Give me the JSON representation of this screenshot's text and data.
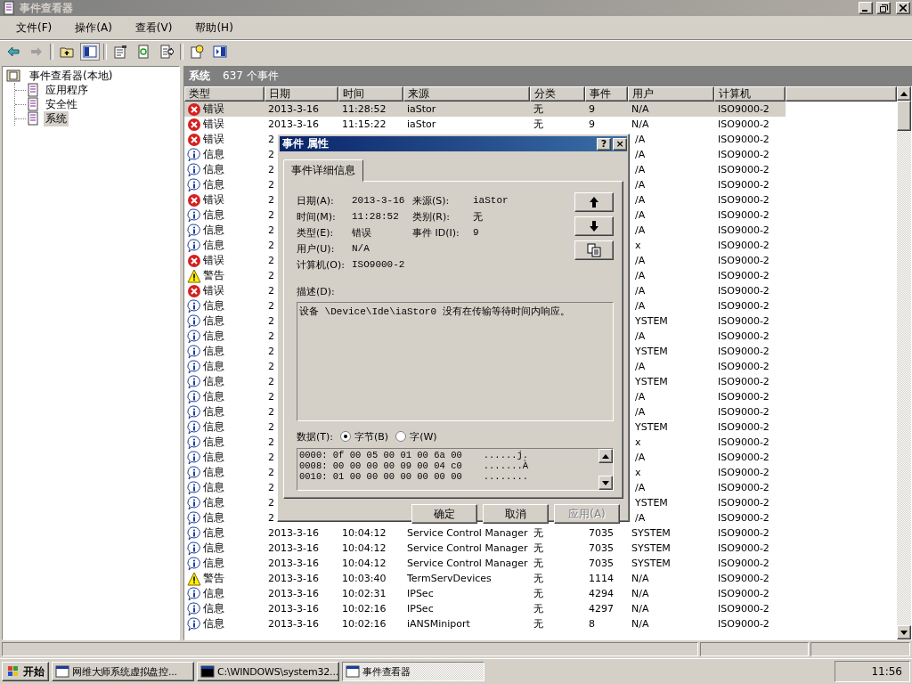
{
  "window": {
    "title": "事件查看器"
  },
  "menu": [
    {
      "label": "文件(F)"
    },
    {
      "label": "操作(A)"
    },
    {
      "label": "查看(V)"
    },
    {
      "label": "帮助(H)"
    }
  ],
  "tree": {
    "label": "事件查看器(本地)",
    "children": [
      {
        "label": "应用程序",
        "selected": false
      },
      {
        "label": "安全性",
        "selected": false
      },
      {
        "label": "系统",
        "selected": true
      }
    ]
  },
  "panel": {
    "title": "系统",
    "count": "637 个事件"
  },
  "table": {
    "columns": [
      "类型",
      "日期",
      "时间",
      "来源",
      "分类",
      "事件",
      "用户",
      "计算机"
    ],
    "rows": [
      {
        "kind": "error",
        "type": "错误",
        "selected": true,
        "date": "2013-3-16",
        "time": "11:28:52",
        "source": "iaStor",
        "category": "无",
        "event": "9",
        "user": "N/A",
        "computer": "ISO9000-2"
      },
      {
        "kind": "error",
        "type": "错误",
        "selected": false,
        "date": "2013-3-16",
        "time": "11:15:22",
        "source": "iaStor",
        "category": "无",
        "event": "9",
        "user": "N/A",
        "computer": "ISO9000-2"
      },
      {
        "kind": "error",
        "type": "错误",
        "selected": false,
        "date": "2",
        "user": "/A",
        "computer": "ISO9000-2"
      },
      {
        "kind": "info",
        "type": "信息",
        "selected": false,
        "date": "2",
        "user": "/A",
        "computer": "ISO9000-2"
      },
      {
        "kind": "info",
        "type": "信息",
        "selected": false,
        "date": "2",
        "user": "/A",
        "computer": "ISO9000-2"
      },
      {
        "kind": "info",
        "type": "信息",
        "selected": false,
        "date": "2",
        "user": "/A",
        "computer": "ISO9000-2"
      },
      {
        "kind": "error",
        "type": "错误",
        "selected": false,
        "date": "2",
        "user": "/A",
        "computer": "ISO9000-2"
      },
      {
        "kind": "info",
        "type": "信息",
        "selected": false,
        "date": "2",
        "user": "/A",
        "computer": "ISO9000-2"
      },
      {
        "kind": "info",
        "type": "信息",
        "selected": false,
        "date": "2",
        "user": "/A",
        "computer": "ISO9000-2"
      },
      {
        "kind": "info",
        "type": "信息",
        "selected": false,
        "date": "2",
        "user": "x",
        "computer": "ISO9000-2"
      },
      {
        "kind": "error",
        "type": "错误",
        "selected": false,
        "date": "2",
        "user": "/A",
        "computer": "ISO9000-2"
      },
      {
        "kind": "warning",
        "type": "警告",
        "selected": false,
        "date": "2",
        "user": "/A",
        "computer": "ISO9000-2"
      },
      {
        "kind": "error",
        "type": "错误",
        "selected": false,
        "date": "2",
        "user": "/A",
        "computer": "ISO9000-2"
      },
      {
        "kind": "info",
        "type": "信息",
        "selected": false,
        "date": "2",
        "user": "/A",
        "computer": "ISO9000-2"
      },
      {
        "kind": "info",
        "type": "信息",
        "selected": false,
        "date": "2",
        "user": "YSTEM",
        "computer": "ISO9000-2"
      },
      {
        "kind": "info",
        "type": "信息",
        "selected": false,
        "date": "2",
        "user": "/A",
        "computer": "ISO9000-2"
      },
      {
        "kind": "info",
        "type": "信息",
        "selected": false,
        "date": "2",
        "user": "YSTEM",
        "computer": "ISO9000-2"
      },
      {
        "kind": "info",
        "type": "信息",
        "selected": false,
        "date": "2",
        "user": "/A",
        "computer": "ISO9000-2"
      },
      {
        "kind": "info",
        "type": "信息",
        "selected": false,
        "date": "2",
        "user": "YSTEM",
        "computer": "ISO9000-2"
      },
      {
        "kind": "info",
        "type": "信息",
        "selected": false,
        "date": "2",
        "user": "/A",
        "computer": "ISO9000-2"
      },
      {
        "kind": "info",
        "type": "信息",
        "selected": false,
        "date": "2",
        "user": "/A",
        "computer": "ISO9000-2"
      },
      {
        "kind": "info",
        "type": "信息",
        "selected": false,
        "date": "2",
        "user": "YSTEM",
        "computer": "ISO9000-2"
      },
      {
        "kind": "info",
        "type": "信息",
        "selected": false,
        "date": "2",
        "user": "x",
        "computer": "ISO9000-2"
      },
      {
        "kind": "info",
        "type": "信息",
        "selected": false,
        "date": "2",
        "user": "/A",
        "computer": "ISO9000-2"
      },
      {
        "kind": "info",
        "type": "信息",
        "selected": false,
        "date": "2",
        "user": "x",
        "computer": "ISO9000-2"
      },
      {
        "kind": "info",
        "type": "信息",
        "selected": false,
        "date": "2",
        "user": "/A",
        "computer": "ISO9000-2"
      },
      {
        "kind": "info",
        "type": "信息",
        "selected": false,
        "date": "2",
        "user": "YSTEM",
        "computer": "ISO9000-2"
      },
      {
        "kind": "info",
        "type": "信息",
        "selected": false,
        "date": "2",
        "user": "/A",
        "computer": "ISO9000-2"
      },
      {
        "kind": "info",
        "type": "信息",
        "selected": false,
        "date": "2013-3-16",
        "time": "10:04:12",
        "source": "Service Control Manager",
        "category": "无",
        "event": "7035",
        "user": "SYSTEM",
        "computer": "ISO9000-2"
      },
      {
        "kind": "info",
        "type": "信息",
        "selected": false,
        "date": "2013-3-16",
        "time": "10:04:12",
        "source": "Service Control Manager",
        "category": "无",
        "event": "7035",
        "user": "SYSTEM",
        "computer": "ISO9000-2"
      },
      {
        "kind": "info",
        "type": "信息",
        "selected": false,
        "date": "2013-3-16",
        "time": "10:04:12",
        "source": "Service Control Manager",
        "category": "无",
        "event": "7035",
        "user": "SYSTEM",
        "computer": "ISO9000-2"
      },
      {
        "kind": "warning",
        "type": "警告",
        "selected": false,
        "date": "2013-3-16",
        "time": "10:03:40",
        "source": "TermServDevices",
        "category": "无",
        "event": "1114",
        "user": "N/A",
        "computer": "ISO9000-2"
      },
      {
        "kind": "info",
        "type": "信息",
        "selected": false,
        "date": "2013-3-16",
        "time": "10:02:31",
        "source": "IPSec",
        "category": "无",
        "event": "4294",
        "user": "N/A",
        "computer": "ISO9000-2"
      },
      {
        "kind": "info",
        "type": "信息",
        "selected": false,
        "date": "2013-3-16",
        "time": "10:02:16",
        "source": "IPSec",
        "category": "无",
        "event": "4297",
        "user": "N/A",
        "computer": "ISO9000-2"
      },
      {
        "kind": "info",
        "type": "信息",
        "selected": false,
        "date": "2013-3-16",
        "time": "10:02:16",
        "source": "iANSMiniport",
        "category": "无",
        "event": "8",
        "user": "N/A",
        "computer": "ISO9000-2"
      }
    ]
  },
  "dialog": {
    "title": "事件 属性",
    "title_buttons": [
      "?",
      "×"
    ],
    "tab": {
      "label": "事件详细信息",
      "selected": true
    },
    "fields_left": [
      {
        "label": "日期(A):",
        "value": "2013-3-16"
      },
      {
        "label": "时间(M):",
        "value": "11:28:52"
      },
      {
        "label": "类型(E):",
        "value": "错误"
      },
      {
        "label": "用户(U):",
        "value": "N/A"
      },
      {
        "label": "计算机(O):",
        "value": "ISO9000-2"
      }
    ],
    "fields_right": [
      {
        "label": "来源(S):",
        "value": "iaStor"
      },
      {
        "label": "类别(R):",
        "value": "无"
      },
      {
        "label": "事件 ID(I):",
        "value": "9"
      }
    ],
    "description_label": "描述(D):",
    "description": "设备 \\Device\\Ide\\iaStor0 没有在传输等待时间内响应。",
    "data_label": "数据(T):",
    "radios": [
      {
        "label": "字节(B)",
        "selected": true
      },
      {
        "label": "字(W)",
        "selected": false
      }
    ],
    "hex": [
      {
        "bytes": "0000: 0f 00 05 00 01 00 6a 00",
        "ascii": "......j."
      },
      {
        "bytes": "0008: 00 00 00 00 09 00 04 c0",
        "ascii": ".......À"
      },
      {
        "bytes": "0010: 01 00 00 00 00 00 00 00",
        "ascii": "........"
      }
    ],
    "buttons": [
      {
        "label": "确定",
        "disabled": false
      },
      {
        "label": "取消",
        "disabled": false
      },
      {
        "label": "应用(A)",
        "disabled": true
      }
    ]
  },
  "taskbar": {
    "start": "开始",
    "items": [
      {
        "label": "网维大师系统虚拟盘控...",
        "selected": false
      },
      {
        "label": "C:\\WINDOWS\\system32...",
        "selected": false
      },
      {
        "label": "事件查看器",
        "selected": true
      }
    ],
    "clock": "11:56"
  }
}
